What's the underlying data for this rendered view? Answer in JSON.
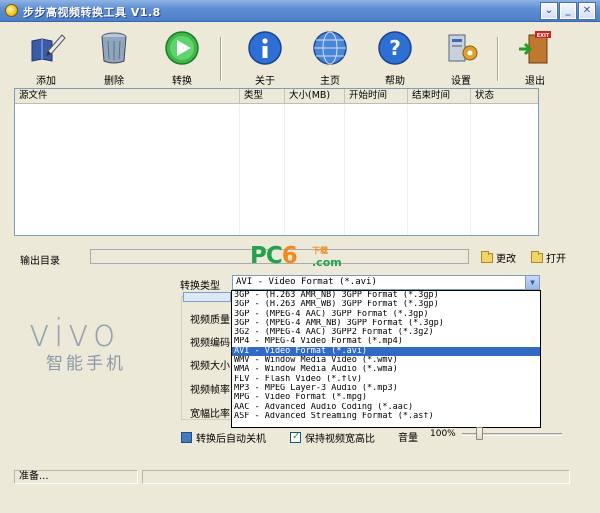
{
  "window": {
    "title": "步步高视频转换工具 V1.8"
  },
  "toolbar": {
    "items": [
      {
        "label": "添加",
        "icon": "add-icon"
      },
      {
        "label": "删除",
        "icon": "trash-icon"
      },
      {
        "label": "转换",
        "icon": "play-icon"
      },
      {
        "label": "关于",
        "icon": "info-icon"
      },
      {
        "label": "主页",
        "icon": "globe-icon"
      },
      {
        "label": "帮助",
        "icon": "help-icon"
      },
      {
        "label": "设置",
        "icon": "settings-icon"
      },
      {
        "label": "退出",
        "icon": "exit-icon"
      }
    ]
  },
  "filelist": {
    "columns": [
      "源文件",
      "类型",
      "大小(MB)",
      "开始时间",
      "结束时间",
      "状态"
    ]
  },
  "output": {
    "label": "输出目录",
    "value": "",
    "change_label": "更改",
    "open_label": "打开"
  },
  "watermark": {
    "brand": "PC",
    "brand_digit": "6",
    "download": "下载",
    "domain": ".com"
  },
  "logo": {
    "brand": "vivo",
    "slogan": "智能手机"
  },
  "convert": {
    "type_label": "转换类型",
    "selected": "AVI - Video Format (*.avi)",
    "options": [
      "3GP - (H.263 AMR_NB) 3GPP Format (*.3gp)",
      "3GP - (H.263 AMR_WB) 3GPP Format (*.3gp)",
      "3GP - (MPEG-4 AAC) 3GPP Format (*.3gp)",
      "3GP - (MPEG-4 AMR_NB) 3GPP Format (*.3gp)",
      "3G2 - (MPEG-4 AAC) 3GPP2 Format (*.3g2)",
      "MP4 - MPEG-4 Video Format (*.mp4)",
      "AVI - Video Format (*.avi)",
      "WMV - Window Media Video (*.wmv)",
      "WMA - Window Media Audio (*.wma)",
      "FLV - Flash Video (*.flv)",
      "MP3 - MPEG Layer-3 Audio (*.mp3)",
      "MPG - Video Format (*.mpg)",
      "AAC - Advanced Audio Coding (*.aac)",
      "ASF - Advanced Streaming Format (*.asf)"
    ],
    "selected_index": 6
  },
  "settings": {
    "rows": [
      "视频质量",
      "视频编码",
      "视频大小",
      "视频帧率",
      "宽幅比率"
    ]
  },
  "options": {
    "auto_shutdown": "转换后自动关机",
    "keep_ratio": "保持视频宽高比",
    "volume_label": "音量",
    "volume_value": "100%",
    "volume_level": 0.15
  },
  "status": {
    "text": "准备..."
  },
  "colors": {
    "title_bar": "#5f8fd3",
    "selection": "#316ac5",
    "pc6_green": "#22a24a",
    "pc6_orange": "#f08a1e"
  }
}
